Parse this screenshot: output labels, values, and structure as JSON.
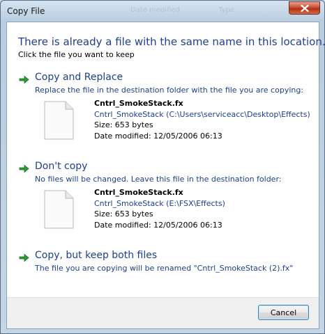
{
  "window": {
    "title": "Copy File",
    "ghost_title_left": "Date modified",
    "ghost_title_right": "Type"
  },
  "dialog": {
    "heading": "There is already a file with the same name in this location.",
    "subheading": "Click the file you want to keep"
  },
  "options": [
    {
      "title": "Copy and Replace",
      "description": "Replace the file in the destination folder with the file you are copying:",
      "file": {
        "name": "Cntrl_SmokeStack.fx",
        "location": "Cntrl_SmokeStack (C:\\Users\\serviceacc\\Desktop\\Effects)",
        "size": "Size: 653 bytes",
        "date_modified": "Date modified: 12/05/2006 06:13"
      }
    },
    {
      "title": "Don't copy",
      "description": "No files will be changed. Leave this file in the destination folder:",
      "file": {
        "name": "Cntrl_SmokeStack.fx",
        "location": "Cntrl_SmokeStack (E:\\FSX\\Effects)",
        "size": "Size: 653 bytes",
        "date_modified": "Date modified: 12/05/2006 06:13"
      }
    },
    {
      "title": "Copy, but keep both files",
      "description": "The file you are copying will be renamed \"Cntrl_SmokeStack (2).fx\""
    }
  ],
  "footer": {
    "cancel_label": "Cancel"
  },
  "icons": {
    "close": "close-icon",
    "option_arrow": "green-arrow-icon",
    "file": "document-icon"
  },
  "colors": {
    "link_blue": "#1e3f8f",
    "arrow_green": "#2e9a32",
    "close_red": "#c84f36"
  }
}
